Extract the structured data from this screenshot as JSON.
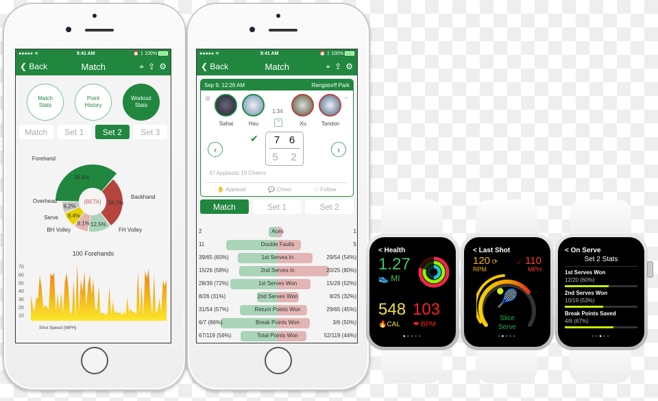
{
  "status_bar": {
    "signal": "●●●●● ",
    "wifi": "wifi-icon",
    "time": "9:41 AM",
    "battery_pct": "100%"
  },
  "phone1": {
    "nav": {
      "back": "Back",
      "title": "Match"
    },
    "circles": [
      {
        "label": "Match\nStats",
        "active": false
      },
      {
        "label": "Point\nHistory",
        "active": false
      },
      {
        "label": "Workout\nStats",
        "active": true
      }
    ],
    "segments": [
      {
        "label": "Match",
        "active": false
      },
      {
        "label": "Set 1",
        "active": false
      },
      {
        "label": "Set 2",
        "active": true
      },
      {
        "label": "Set 3",
        "active": false
      }
    ],
    "donut_center": "(BETA)",
    "donut_caption": "100 Forehands",
    "speed_axis_label": "Shot Speed (MPH)"
  },
  "phone2": {
    "nav": {
      "back": "Back",
      "title": "Match"
    },
    "card": {
      "date": "Sep 9, 12:26 AM",
      "location": "Rengstorff Park",
      "duration": "1:34",
      "players": [
        "Sahai",
        "Hsu",
        "Xu",
        "Tandon"
      ],
      "score": {
        "team1": [
          "7",
          "6"
        ],
        "team2": [
          "5",
          "2"
        ]
      },
      "winner_check": "✔",
      "social": "47 Applauds 19 Cheers",
      "actions": [
        "Applaud",
        "Cheer",
        "Follow"
      ]
    },
    "segments": [
      {
        "label": "Match",
        "active": true
      },
      {
        "label": "Set 1",
        "active": false
      },
      {
        "label": "Set 2",
        "active": false
      }
    ],
    "stats": [
      {
        "name": "Aces",
        "left": "2",
        "right": "1",
        "lf": 0.12,
        "rf": 0.06
      },
      {
        "name": "Double Faults",
        "left": "11",
        "right": "5",
        "lf": 0.68,
        "rf": 0.31
      },
      {
        "name": "1st Serves In",
        "left": "39/65 (60%)",
        "right": "29/54 (54%)",
        "lf": 0.53,
        "rf": 0.46
      },
      {
        "name": "2nd Serves In",
        "left": "15/26 (58%)",
        "right": "20/25 (80%)",
        "lf": 0.51,
        "rf": 0.68
      },
      {
        "name": "1st Serves Won",
        "left": "28/39 (72%)",
        "right": "15/29 (52%)",
        "lf": 0.63,
        "rf": 0.44
      },
      {
        "name": "2nd Serves Won",
        "left": "8/26 (31%)",
        "right": "8/25 (32%)",
        "lf": 0.27,
        "rf": 0.28
      },
      {
        "name": "Return Points Won",
        "left": "31/54 (57%)",
        "right": "29/65 (45%)",
        "lf": 0.5,
        "rf": 0.39
      },
      {
        "name": "Break Points Won",
        "left": "6/7 (86%)",
        "right": "3/6 (50%)",
        "lf": 0.75,
        "rf": 0.43
      },
      {
        "name": "Total Points Won",
        "left": "67/119 (56%)",
        "right": "52/119 (44%)",
        "lf": 0.49,
        "rf": 0.38
      }
    ]
  },
  "watch1": {
    "back": "< Health",
    "distance": "1.27",
    "distance_unit": "MI",
    "calories": "548",
    "calories_unit": "CAL",
    "heart_rate": "103",
    "heart_rate_unit": "BPM",
    "page": 1
  },
  "watch2": {
    "back": "< Last Shot",
    "spin": "120",
    "spin_unit": "RPM",
    "speed": "110",
    "speed_unit": "MPH",
    "shot_type": "Slice",
    "shot_name": "Serve",
    "page": 2
  },
  "watch3": {
    "back": "< On Serve",
    "title": "Set 2 Stats",
    "items": [
      {
        "label": "1st Serves Won",
        "value": "12/20 (60%)",
        "fraction": 0.6
      },
      {
        "label": "2nd Serves Won",
        "value": "10/19 (53%)",
        "fraction": 0.53
      },
      {
        "label": "Break Points Saved",
        "value": "4/6 (67%)",
        "fraction": 0.67
      }
    ],
    "page": 3
  },
  "colors": {
    "brand_green": "#21873f",
    "loss_red": "#b5443c",
    "watch_lime": "#c6f000"
  },
  "chart_data": [
    {
      "type": "pie",
      "title": "100 Forehands",
      "center_label": "(BETA)",
      "categories": [
        "Forehand",
        "Backhand",
        "FH Volley",
        "BH Volley",
        "Serve",
        "Overhead"
      ],
      "values": [
        36.6,
        28.2,
        12.5,
        8.1,
        8.4,
        6.2
      ],
      "colors": [
        "#21873f",
        "#b5443c",
        "#a9d4b8",
        "#e3b5b4",
        "#e6d000",
        "#c4c4c4"
      ],
      "highlighted": "Forehand"
    },
    {
      "type": "area",
      "xlabel": "Shot Speed (MPH)",
      "ylabel": "",
      "yticks": [
        10,
        20,
        30,
        40,
        50,
        60,
        70
      ],
      "ylim": [
        3,
        74
      ],
      "values": [
        33,
        22,
        14,
        31,
        30,
        58,
        45,
        18,
        22,
        20,
        16,
        61,
        58,
        62,
        14,
        36,
        15,
        38,
        12,
        50,
        62,
        45,
        10,
        15,
        52,
        8,
        72,
        14,
        53,
        40,
        64,
        20,
        46,
        60,
        35,
        53,
        20,
        15,
        46,
        12,
        13,
        12,
        10,
        13,
        44,
        10,
        27,
        12,
        15,
        12,
        13,
        10,
        14,
        10,
        31,
        14,
        18,
        13,
        14,
        10,
        64,
        12,
        46,
        10,
        64,
        56,
        66,
        30,
        10,
        58,
        12,
        16,
        30,
        14,
        53,
        46,
        53
      ]
    }
  ]
}
